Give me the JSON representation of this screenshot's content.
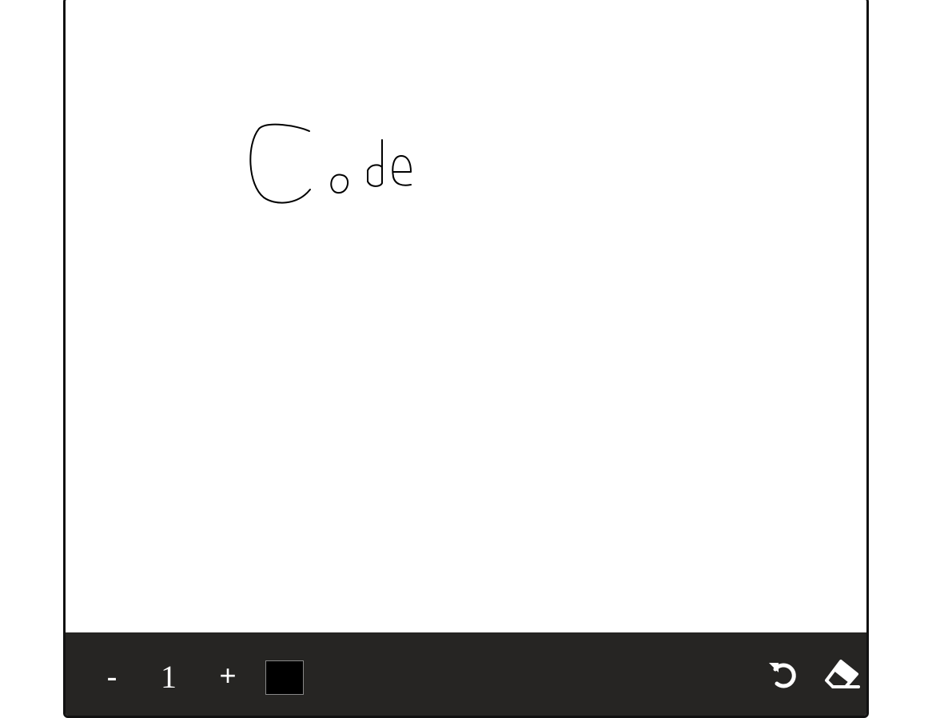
{
  "canvas": {
    "drawing_text": "Code",
    "stroke_color": "#000000"
  },
  "toolbar": {
    "decrease_label": "-",
    "brush_size": "1",
    "increase_label": "+",
    "current_color": "#000000",
    "undo_icon": "undo-icon",
    "eraser_icon": "eraser-icon"
  }
}
